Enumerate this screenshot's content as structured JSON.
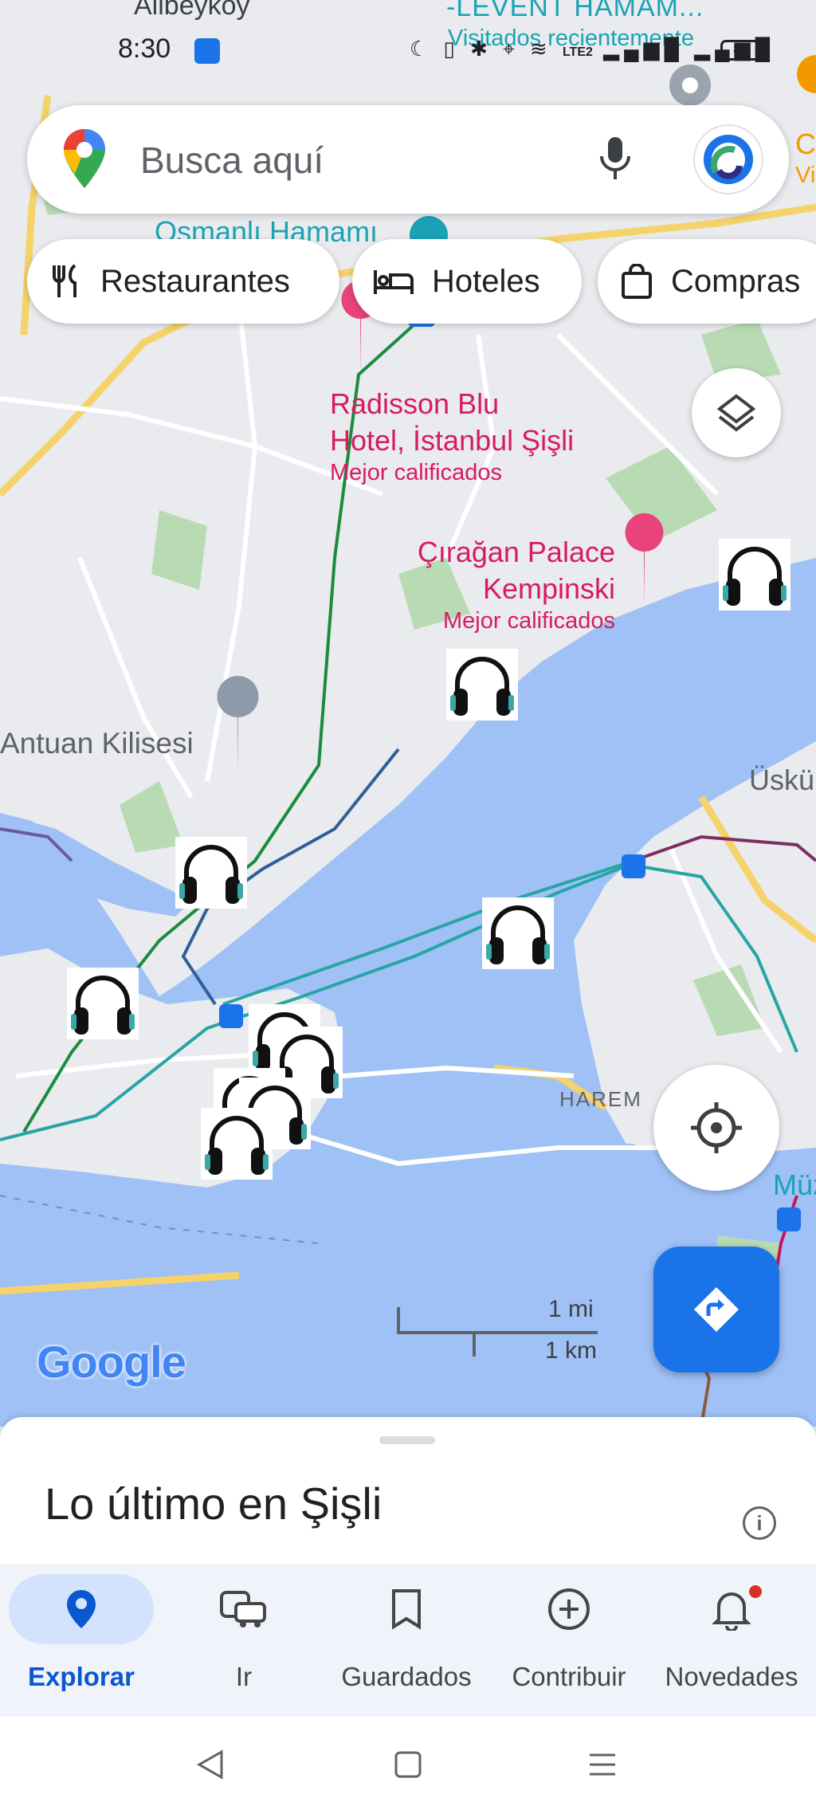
{
  "status_bar": {
    "time": "8:30",
    "battery": "81",
    "network": "LTE2"
  },
  "search": {
    "placeholder": "Busca aquí",
    "mic_icon": "mic-icon",
    "account_icon": "account-avatar"
  },
  "chips": [
    {
      "label": "Restaurantes",
      "icon": "fork-knife-icon"
    },
    {
      "label": "Hoteles",
      "icon": "bed-icon"
    },
    {
      "label": "Compras",
      "icon": "shopping-bag-icon"
    }
  ],
  "map_labels": {
    "top_left_area": "Alibeyköy",
    "top_place": "-LEVENT HAMAM...",
    "top_place_sub": "Visitados recientemente",
    "hamam": "Osmanlı Hamamı",
    "antuan": "Antuan Kilisesi",
    "uskudar": "Üskü",
    "harem": "HAREM",
    "muze": "Müze",
    "top_right_partial": "C",
    "top_right_partial_sub": "Vi",
    "google": "Google"
  },
  "pois": [
    {
      "name_line1": "Radisson Blu",
      "name_line2": "Hotel, İstanbul Şişli",
      "sub": "Mejor calificados"
    },
    {
      "name_line1": "Çırağan Palace",
      "name_line2": "Kempinski",
      "sub": "Mejor calificados"
    }
  ],
  "scale": {
    "miles": "1 mi",
    "km": "1 km"
  },
  "sheet": {
    "title": "Lo último en Şişli"
  },
  "bottom_nav": [
    {
      "label": "Explorar",
      "icon": "explore-pin-icon",
      "active": true
    },
    {
      "label": "Ir",
      "icon": "commute-icon",
      "active": false
    },
    {
      "label": "Guardados",
      "icon": "bookmark-icon",
      "active": false
    },
    {
      "label": "Contribuir",
      "icon": "add-circle-icon",
      "active": false
    },
    {
      "label": "Novedades",
      "icon": "bell-icon",
      "active": false,
      "badge": true
    }
  ],
  "colors": {
    "water": "#9fc1f6",
    "land": "#e9ebee",
    "park": "#b9dbb4",
    "highway": "#f5d26a",
    "accent": "#1a73e8",
    "poi": "#d81b60",
    "metro_green": "#1b8c3d",
    "metro_teal": "#27a5a5"
  }
}
